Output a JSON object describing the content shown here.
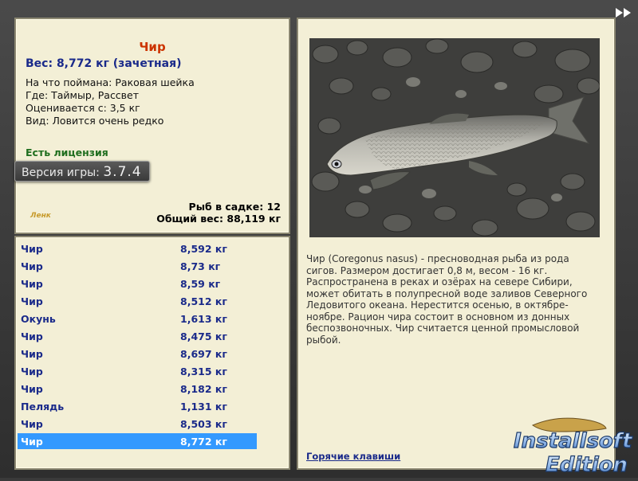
{
  "fish": {
    "name": "Чир",
    "weight_line": "Вес: 8,772 кг (зачетная)",
    "details": [
      "На что поймана: Раковая шейка",
      "Где: Таймыр, Рассвет",
      "Оценивается с: 3,5 кг",
      "Вид: Ловится очень редко"
    ],
    "license": "Есть лицензия"
  },
  "version": {
    "label": "Версия игры:",
    "number": "3.7.4"
  },
  "keepnet": {
    "count_line": "Рыб в садке: 12",
    "total_line": "Общий вес: 88,119 кг",
    "logo_text": "Ленк"
  },
  "catch_list": [
    {
      "name": "Чир",
      "weight": "8,592 кг"
    },
    {
      "name": "Чир",
      "weight": "8,73 кг"
    },
    {
      "name": "Чир",
      "weight": "8,59 кг"
    },
    {
      "name": "Чир",
      "weight": "8,512 кг"
    },
    {
      "name": "Окунь",
      "weight": "1,613 кг"
    },
    {
      "name": "Чир",
      "weight": "8,475 кг"
    },
    {
      "name": "Чир",
      "weight": "8,697 кг"
    },
    {
      "name": "Чир",
      "weight": "8,315 кг"
    },
    {
      "name": "Чир",
      "weight": "8,182 кг"
    },
    {
      "name": "Пелядь",
      "weight": "1,131 кг"
    },
    {
      "name": "Чир",
      "weight": "8,503 кг"
    },
    {
      "name": "Чир",
      "weight": "8,772 кг"
    }
  ],
  "selected_index": 11,
  "description": "Чир (Coregonus nasus) - пресноводная рыба из рода сигов. Размером достигает 0,8 м, весом - 16 кг. Распространена в реках и озёрах на севере Сибири, может обитать в полупресной воде заливов Северного Ледовитого океана. Нерестится осенью, в октябре-ноябре. Рацион чира состоит в основном из донных беспозвоночных. Чир считается ценной промысловой рыбой.",
  "hotkeys_link": "Горячие клавиши",
  "watermark": {
    "line1": "Installsoft",
    "line2": "Edition"
  },
  "icons": {
    "forward": "fast-forward-icon",
    "photo": "fish-photo"
  },
  "colors": {
    "panel_bg": "#f3efd6",
    "accent_red": "#cc3300",
    "accent_blue": "#1a2a8a",
    "selection": "#3399ff",
    "license_green": "#1f6e1f"
  }
}
